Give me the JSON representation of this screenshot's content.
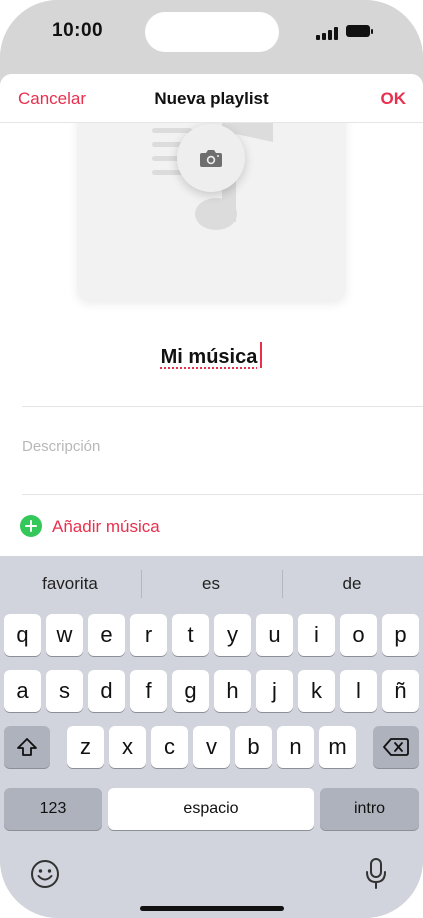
{
  "status_bar": {
    "time": "10:00"
  },
  "sheet": {
    "cancel_label": "Cancelar",
    "title": "Nueva playlist",
    "ok_label": "OK",
    "playlist_name": "Mi música",
    "description_placeholder": "Descripción",
    "add_music_label": "Añadir música"
  },
  "keyboard": {
    "suggestions": [
      "favorita",
      "es",
      "de"
    ],
    "row1": [
      "q",
      "w",
      "e",
      "r",
      "t",
      "y",
      "u",
      "i",
      "o",
      "p"
    ],
    "row2": [
      "a",
      "s",
      "d",
      "f",
      "g",
      "h",
      "j",
      "k",
      "l",
      "ñ"
    ],
    "row3": [
      "z",
      "x",
      "c",
      "v",
      "b",
      "n",
      "m"
    ],
    "numbers_label": "123",
    "space_label": "espacio",
    "return_label": "intro"
  },
  "colors": {
    "accent": "#e8304e",
    "add_icon": "#34c759",
    "keyboard_bg": "#d1d4dc"
  },
  "icons": [
    "camera-icon",
    "plus-circle-icon",
    "shift-icon",
    "delete-icon",
    "emoji-icon",
    "microphone-icon"
  ]
}
